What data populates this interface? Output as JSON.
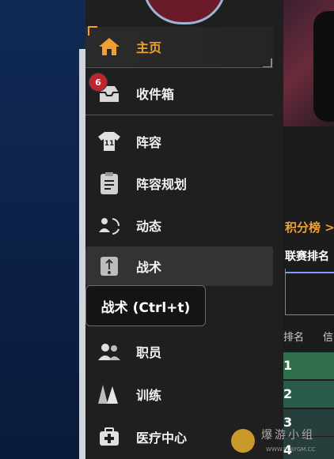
{
  "sidebar": {
    "items": [
      {
        "label": "主页",
        "icon": "home-icon",
        "active": true
      },
      {
        "label": "收件箱",
        "icon": "inbox-icon",
        "badge": "6"
      },
      {
        "label": "阵容",
        "icon": "jersey-icon"
      },
      {
        "label": "阵容规划",
        "icon": "clipboard-icon"
      },
      {
        "label": "动态",
        "icon": "dynamics-icon"
      },
      {
        "label": "战术",
        "icon": "tactics-icon",
        "hover": true
      },
      {
        "label": "职员",
        "icon": "staff-icon"
      },
      {
        "label": "训练",
        "icon": "training-cones-icon"
      },
      {
        "label": "医疗中心",
        "icon": "medical-kit-icon"
      }
    ]
  },
  "tooltip": {
    "text": "战术 (Ctrl+t)"
  },
  "main": {
    "standings_link": "积分榜 >",
    "league_rank_title": "联赛排名",
    "table_headers": [
      "排名",
      "信"
    ],
    "rows": [
      "1",
      "2",
      "3",
      "4"
    ]
  },
  "watermark": {
    "text": "爆游小组",
    "url": "WWW.PLAYGM.CC"
  },
  "colors": {
    "accent": "#f0a030",
    "badge": "#c0242e",
    "sidebar_bg": "#1f1f1f",
    "row1": "#2f6e4a",
    "row2": "#2a5a4a"
  }
}
